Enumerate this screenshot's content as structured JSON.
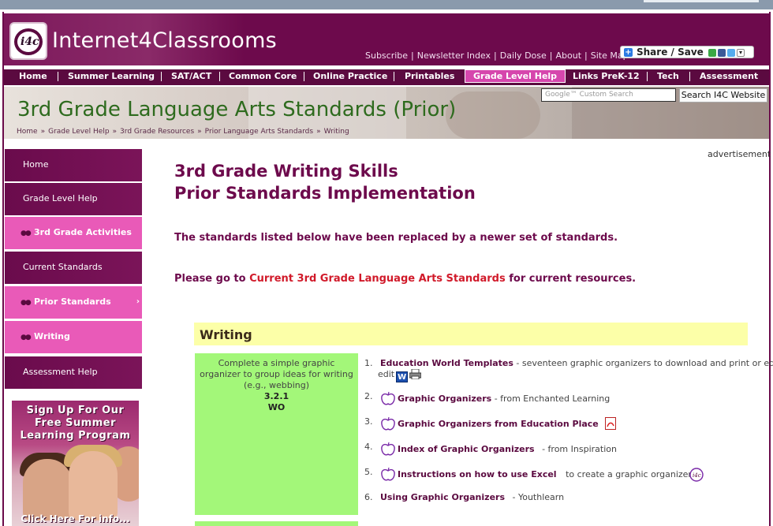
{
  "site": {
    "brand": "Internet4Classrooms",
    "logo_text": "i4c",
    "top_links": [
      "Subscribe",
      "Newsletter Index",
      "Daily Dose",
      "About",
      "Site Map"
    ],
    "share_label": "Share / Save"
  },
  "nav": {
    "items": [
      "Home",
      "Summer Learning",
      "SAT/ACT",
      "Common Core",
      "Online Practice",
      "Printables",
      "Grade Level Help",
      "Links PreK-12",
      "Tech",
      "Assessment"
    ],
    "active": "Grade Level Help"
  },
  "banner": {
    "title": "3rd Grade Language Arts Standards (Prior)",
    "breadcrumb": [
      "Home",
      "Grade Level Help",
      "3rd Grade Resources",
      "Prior Language Arts Standards",
      "Writing"
    ],
    "search_placeholder": "Google™ Custom Search",
    "search_button": "Search I4C Website"
  },
  "sidebar": {
    "items": [
      {
        "label": "Home",
        "style": "dark"
      },
      {
        "label": "Grade Level Help",
        "style": "dark"
      },
      {
        "label": "3rd Grade Activities",
        "style": "pink"
      },
      {
        "label": "Current Standards",
        "style": "dark"
      },
      {
        "label": "Prior Standards",
        "style": "pink"
      },
      {
        "label": "Writing",
        "style": "pink"
      },
      {
        "label": "Assessment Help",
        "style": "dark"
      }
    ],
    "promo": {
      "line1": "Sign Up For Our",
      "line2": "Free Summer",
      "line3": "Learning Program",
      "cta": "Click Here For info..."
    }
  },
  "advertisement_label": "advertisement",
  "main": {
    "heading_line1": "3rd Grade Writing Skills",
    "heading_line2": "Prior Standards Implementation",
    "notice1": "The standards listed below have been replaced by a newer set of standards.",
    "notice2_prefix": "Please go to",
    "notice2_link": "Current 3rd Grade Language Arts Standards",
    "notice2_suffix": "for current resources.",
    "section_title": "Writing",
    "standard": {
      "description": "Complete a simple graphic organizer to group ideas for writing (e.g., webbing)",
      "code": "3.2.1",
      "type": "WO"
    },
    "resources": [
      {
        "num": "1.",
        "title": "Education World Templates",
        "desc": "- seventeen graphic organizers to download and print or edit"
      },
      {
        "num": "2.",
        "title": "Graphic Organizers",
        "desc": "- from Enchanted Learning"
      },
      {
        "num": "3.",
        "title": "Graphic Organizers from Education Place",
        "desc": ""
      },
      {
        "num": "4.",
        "title": "Index of Graphic Organizers",
        "desc": "- from Inspiration"
      },
      {
        "num": "5.",
        "title": "Instructions on how to use Excel",
        "desc": "to create a graphic organizer"
      },
      {
        "num": "6.",
        "title": "Using Graphic Organizers",
        "desc": "- Youthlearn"
      }
    ]
  },
  "colors": {
    "brand_purple": "#6d0a4c",
    "nav_purple": "#5b0a40",
    "pink": "#e95ab8",
    "green": "#a3f779",
    "yellow": "#fcffa8",
    "link_red": "#d11a2a"
  }
}
